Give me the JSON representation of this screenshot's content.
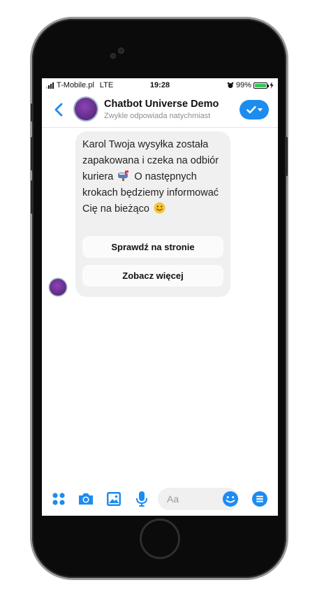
{
  "status_bar": {
    "carrier": "T-Mobile.pl",
    "network": "LTE",
    "time": "19:28",
    "battery": "99%",
    "battery_level": 0.99,
    "alarm_icon": "alarm-clock-icon",
    "charging_icon": "bolt-icon"
  },
  "header": {
    "title": "Chatbot Universe Demo",
    "subtitle": "Zwykle odpowiada natychmiast"
  },
  "message": {
    "line1": "Karol Twoja wysyłka została zapakowana i czeka na odbiór kuriera",
    "mailbox_icon": "mailbox-icon",
    "line2": "O następnych krokach będziemy informować Cię na bieżąco",
    "emoji_icon": "smiley-icon"
  },
  "quick_replies": [
    {
      "label": "Sprawdź na stronie"
    },
    {
      "label": "Zobacz więcej"
    }
  ],
  "composer": {
    "placeholder": "Aa"
  },
  "colors": {
    "accent": "#1d8cf0",
    "bubble": "#f0f0f0",
    "avatar": "#6b2f91"
  }
}
